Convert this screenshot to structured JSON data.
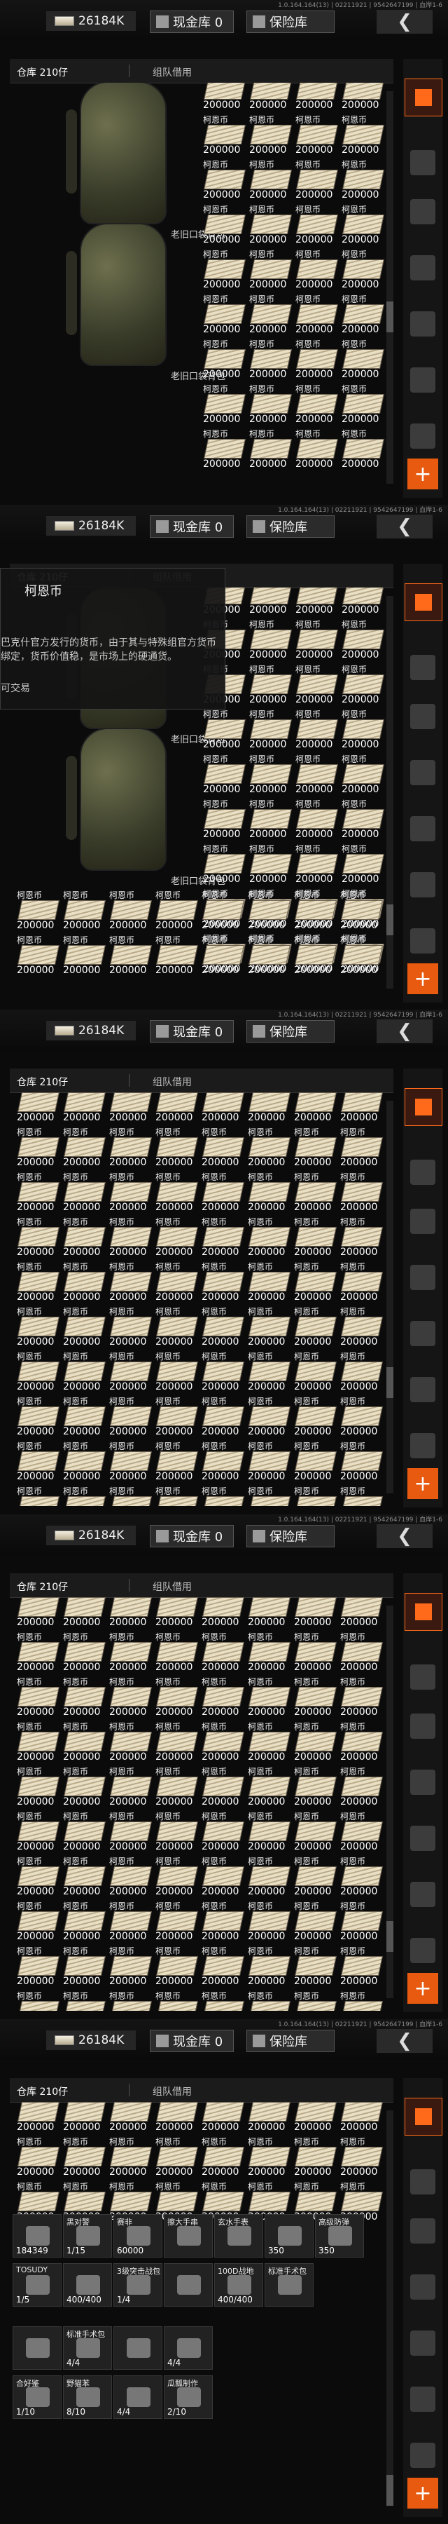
{
  "header": {
    "money": "26184K",
    "cash_vault": "现金库 0",
    "safe_vault": "保险库",
    "build_info": "1.0.164.164(13) | 02211921 | 9542647199 | 血岸1-6"
  },
  "tabs": {
    "warehouse": "仓库 210仔",
    "team": "组队借用"
  },
  "currency": {
    "name": "柯恩币",
    "amount": "200000"
  },
  "backpack_name": "老旧口袋背包",
  "popup": {
    "title": "柯恩币",
    "desc": "巴克什官方发行的货币，由于其与特殊组官方货币绑定，货币价值稳，是市场上的硬通货。",
    "footer": "可交易"
  },
  "bottom": {
    "items": [
      {
        "name": "",
        "qty": "184349"
      },
      {
        "name": "黑对警",
        "qty": "1/15"
      },
      {
        "name": "赛非",
        "qty": "60000"
      },
      {
        "name": "擦大手串",
        "qty": ""
      },
      {
        "name": "玄水手表",
        "qty": ""
      },
      {
        "name": "",
        "qty": "350"
      },
      {
        "name": "高级防弹",
        "qty": "350"
      }
    ],
    "row2": [
      {
        "name": "TOSUDY",
        "qty": "1/5"
      },
      {
        "name": "",
        "qty": "400/400"
      },
      {
        "name": "3级突击战包",
        "qty": "1/4"
      },
      {
        "name": "",
        "qty": ""
      },
      {
        "name": "100D战地",
        "qty": "400/400"
      },
      {
        "name": "标准手术包",
        "qty": ""
      }
    ],
    "row3": [
      {
        "name": "",
        "qty": ""
      },
      {
        "name": "标准手术包",
        "qty": "4/4"
      },
      {
        "name": "",
        "qty": ""
      },
      {
        "name": "",
        "qty": "4/4"
      }
    ],
    "row4": [
      {
        "name": "合好鉴",
        "qty": "1/10"
      },
      {
        "name": "野猫苯",
        "qty": "8/10"
      },
      {
        "name": "",
        "qty": "4/4"
      },
      {
        "name": "瓜瓢制作",
        "qty": "2/10"
      }
    ]
  },
  "colors": {
    "accent": "#e85a10",
    "bg": "#0b0b0b"
  }
}
